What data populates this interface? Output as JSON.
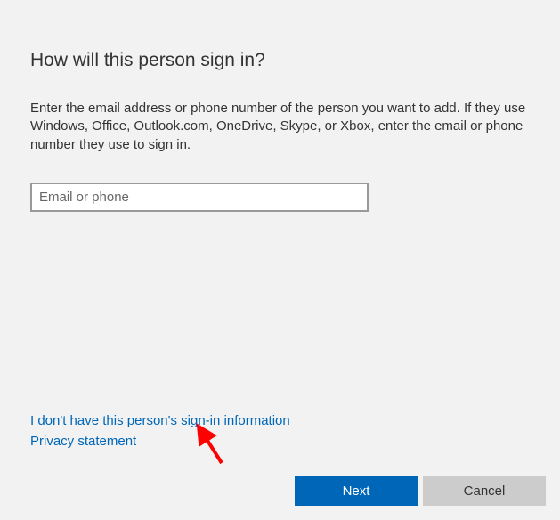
{
  "title": "How will this person sign in?",
  "description": "Enter the email address or phone number of the person you want to add. If they use Windows, Office, Outlook.com, OneDrive, Skype, or Xbox, enter the email or phone number they use to sign in.",
  "input": {
    "placeholder": "Email or phone",
    "value": ""
  },
  "links": {
    "no_signin_info": "I don't have this person's sign-in information",
    "privacy": "Privacy statement"
  },
  "buttons": {
    "next": "Next",
    "cancel": "Cancel"
  }
}
